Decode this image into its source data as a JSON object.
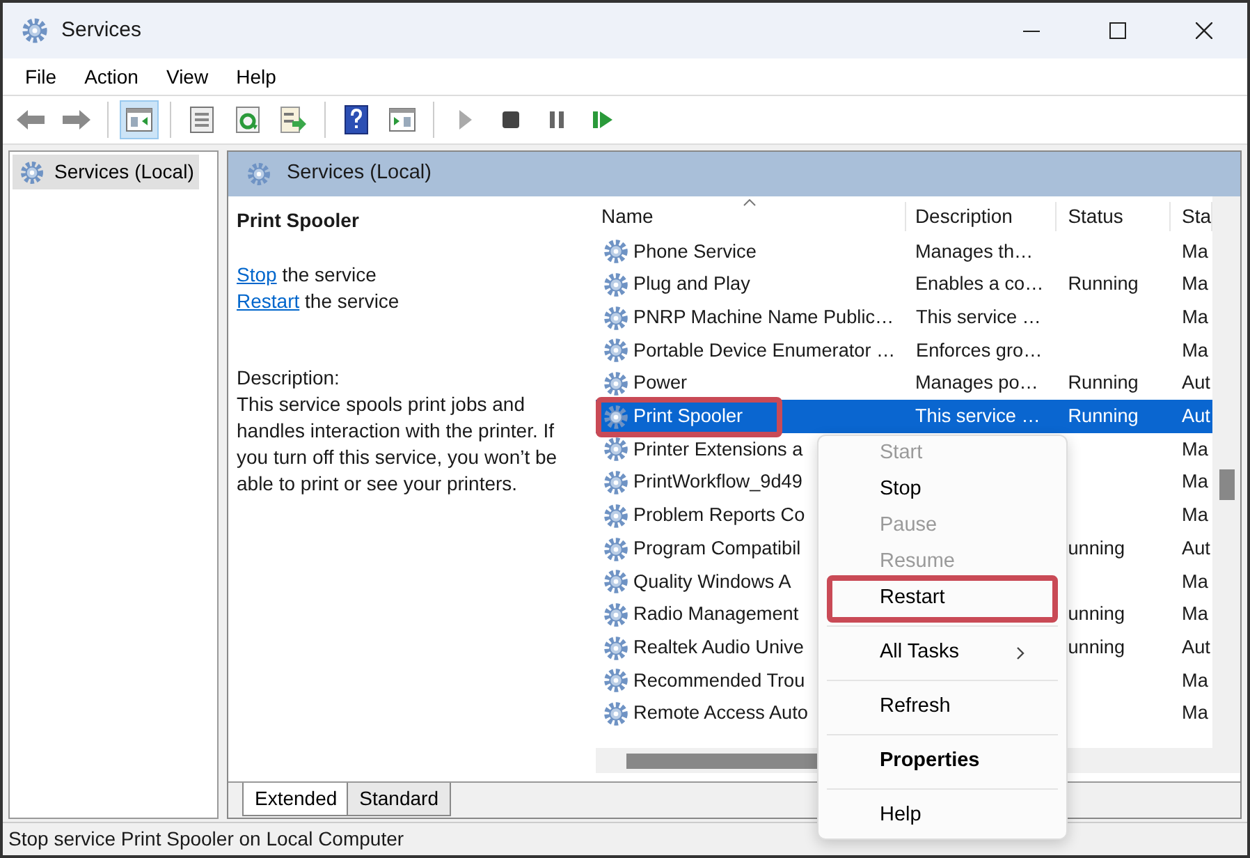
{
  "window": {
    "title": "Services"
  },
  "menu_bar": [
    "File",
    "Action",
    "View",
    "Help"
  ],
  "toolbar": [
    [
      {
        "kind": "back",
        "pressed": false
      },
      {
        "kind": "forward",
        "pressed": false
      }
    ],
    [
      {
        "kind": "tree",
        "pressed": true
      }
    ],
    [
      {
        "kind": "sheet",
        "pressed": false
      },
      {
        "kind": "refresh",
        "pressed": false
      },
      {
        "kind": "export",
        "pressed": false
      }
    ],
    [
      {
        "kind": "help",
        "pressed": false
      },
      {
        "kind": "pane",
        "pressed": false
      }
    ],
    [
      {
        "kind": "play",
        "pressed": false
      },
      {
        "kind": "stop",
        "pressed": false
      },
      {
        "kind": "pause",
        "pressed": false
      },
      {
        "kind": "resume",
        "pressed": false
      }
    ]
  ],
  "tree": [
    {
      "label": "Services (Local)",
      "selected": true
    }
  ],
  "pane_header": "Services (Local)",
  "details": {
    "title": "Print Spooler",
    "actions": [
      {
        "link": "Stop",
        "text": "the service"
      },
      {
        "link": "Restart",
        "text": "the service"
      }
    ],
    "description_label": "Description:",
    "description": "This service spools print jobs and handles interaction with the printer. If you turn off this service, you won’t be able to print or see your printers."
  },
  "table": {
    "columns": [
      "Name",
      "Description",
      "Status",
      "Sta"
    ],
    "rows": [
      {
        "name": "Phone Service",
        "description": "Manages th…",
        "status": "",
        "startup": "Ma",
        "selected": false,
        "annotated": false
      },
      {
        "name": "Plug and Play",
        "description": "Enables a co…",
        "status": "Running",
        "startup": "Ma",
        "selected": false,
        "annotated": false
      },
      {
        "name": "PNRP Machine Name Public…",
        "description": "This service …",
        "status": "",
        "startup": "Ma",
        "selected": false,
        "annotated": false
      },
      {
        "name": "Portable Device Enumerator …",
        "description": "Enforces gro…",
        "status": "",
        "startup": "Ma",
        "selected": false,
        "annotated": false
      },
      {
        "name": "Power",
        "description": "Manages po…",
        "status": "Running",
        "startup": "Aut",
        "selected": false,
        "annotated": false
      },
      {
        "name": "Print Spooler",
        "description": "This service …",
        "status": "Running",
        "startup": "Aut",
        "selected": true,
        "annotated": true
      },
      {
        "name": "Printer Extensions a",
        "description": "",
        "status": "",
        "startup": "Ma",
        "selected": false,
        "annotated": false
      },
      {
        "name": "PrintWorkflow_9d49",
        "description": "",
        "status": "",
        "startup": "Ma",
        "selected": false,
        "annotated": false
      },
      {
        "name": "Problem Reports Co",
        "description": "",
        "status": "",
        "startup": "Ma",
        "selected": false,
        "annotated": false
      },
      {
        "name": "Program Compatibil",
        "description": "",
        "status": "unning",
        "startup": "Aut",
        "selected": false,
        "annotated": false
      },
      {
        "name": "Quality Windows A",
        "description": "",
        "status": "",
        "startup": "Ma",
        "selected": false,
        "annotated": false
      },
      {
        "name": "Radio Management",
        "description": "",
        "status": "unning",
        "startup": "Ma",
        "selected": false,
        "annotated": false
      },
      {
        "name": "Realtek Audio Unive",
        "description": "",
        "status": "unning",
        "startup": "Aut",
        "selected": false,
        "annotated": false
      },
      {
        "name": "Recommended Trou",
        "description": "",
        "status": "",
        "startup": "Ma",
        "selected": false,
        "annotated": false
      },
      {
        "name": "Remote Access Auto",
        "description": "",
        "status": "",
        "startup": "Ma",
        "selected": false,
        "annotated": false
      }
    ]
  },
  "context_menu": [
    {
      "kind": "item",
      "label": "Start",
      "disabled": true,
      "default": false,
      "annotated": false
    },
    {
      "kind": "item",
      "label": "Stop",
      "disabled": false,
      "default": false,
      "annotated": false
    },
    {
      "kind": "item",
      "label": "Pause",
      "disabled": true,
      "default": false,
      "annotated": false
    },
    {
      "kind": "item",
      "label": "Resume",
      "disabled": true,
      "default": false,
      "annotated": false
    },
    {
      "kind": "item",
      "label": "Restart",
      "disabled": false,
      "default": false,
      "annotated": true
    },
    {
      "kind": "separator"
    },
    {
      "kind": "submenu",
      "label": "All Tasks",
      "disabled": false,
      "default": false,
      "annotated": false
    },
    {
      "kind": "separator"
    },
    {
      "kind": "item",
      "label": "Refresh",
      "disabled": false,
      "default": false,
      "annotated": false
    },
    {
      "kind": "separator"
    },
    {
      "kind": "item",
      "label": "Properties",
      "disabled": false,
      "default": true,
      "annotated": false
    },
    {
      "kind": "separator"
    },
    {
      "kind": "item",
      "label": "Help",
      "disabled": false,
      "default": false,
      "annotated": false
    }
  ],
  "view_tabs": [
    {
      "label": "Extended",
      "selected": true
    },
    {
      "label": "Standard",
      "selected": false
    }
  ],
  "status_bar": "Stop service Print Spooler on Local Computer"
}
